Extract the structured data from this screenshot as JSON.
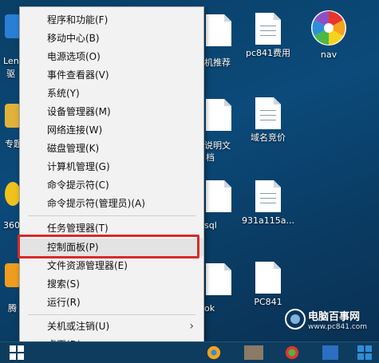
{
  "menu": {
    "items": [
      {
        "label": "程序和功能(F)"
      },
      {
        "label": "移动中心(B)"
      },
      {
        "label": "电源选项(O)"
      },
      {
        "label": "事件查看器(V)"
      },
      {
        "label": "系统(Y)"
      },
      {
        "label": "设备管理器(M)"
      },
      {
        "label": "网络连接(W)"
      },
      {
        "label": "磁盘管理(K)"
      },
      {
        "label": "计算机管理(G)"
      },
      {
        "label": "命令提示符(C)"
      },
      {
        "label": "命令提示符(管理员)(A)"
      },
      {
        "label": "任务管理器(T)"
      },
      {
        "label": "控制面板(P)"
      },
      {
        "label": "文件资源管理器(E)"
      },
      {
        "label": "搜索(S)"
      },
      {
        "label": "运行(R)"
      },
      {
        "label": "关机或注销(U)"
      },
      {
        "label": "桌面(D)"
      }
    ],
    "highlight_color": "#d62b2b"
  },
  "desktop": {
    "icons": [
      {
        "label": "pc841费用"
      },
      {
        "label": "nav"
      },
      {
        "label": "域名竞价"
      },
      {
        "label": "931a115a..."
      },
      {
        "label": "PC841"
      }
    ],
    "partials": {
      "p1": "Len",
      "p2": "驱",
      "p3": "专题",
      "p4": "360",
      "p5": "腾",
      "p6": "机推荐",
      "p7": "说明文",
      "p8": "档",
      "p9": "sql",
      "p10": "ok"
    }
  },
  "watermark": {
    "title": "电脑百事网",
    "url": "www.pc841.com"
  }
}
